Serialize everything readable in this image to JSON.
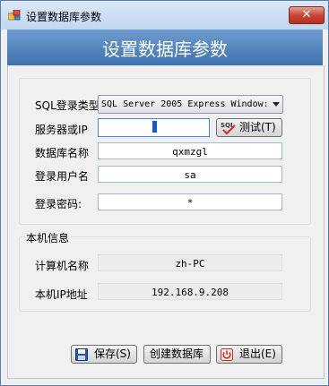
{
  "window": {
    "title": "设置数据库参数",
    "close_glyph": "✕"
  },
  "banner": {
    "title": "设置数据库参数"
  },
  "db_settings": {
    "sql_login_type": {
      "label": "SQL登录类型",
      "value": "SQL Server 2005 Express Window:"
    },
    "server_ip": {
      "label": "服务器或IP",
      "value": ""
    },
    "test_button": {
      "label": "测试(T)",
      "icon_text": "SQL"
    },
    "database_name": {
      "label": "数据库名称",
      "value": "qxmzgl"
    },
    "login_user": {
      "label": "登录用户名",
      "value": "sa"
    },
    "login_password": {
      "label": "登录密码:",
      "value": "*"
    }
  },
  "local_info": {
    "title": "本机信息",
    "computer_name": {
      "label": "计算机名称",
      "value": "zh-PC"
    },
    "local_ip": {
      "label": "本机IP地址",
      "value": "192.168.9.208"
    }
  },
  "footer": {
    "save_label": "保存(S)",
    "create_db_label": "创建数据库",
    "exit_label": "退出(E)"
  },
  "icons": {
    "app": "app-icon",
    "save": "floppy-disk-icon",
    "exit": "power-icon",
    "test": "sql-check-icon"
  },
  "colors": {
    "banner": "#4f80b8",
    "close": "#c8453a"
  }
}
